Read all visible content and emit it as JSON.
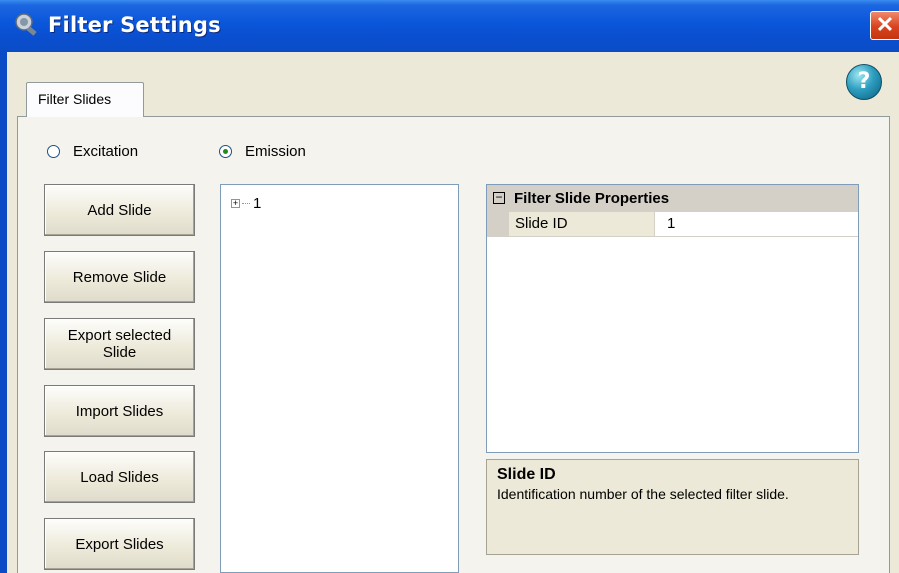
{
  "window": {
    "title": "Filter Settings",
    "close_glyph": "✕"
  },
  "help_glyph": "?",
  "tabs": [
    {
      "label": "Filter Slides"
    }
  ],
  "radios": {
    "excitation": {
      "label": "Excitation",
      "checked": false
    },
    "emission": {
      "label": "Emission",
      "checked": true
    }
  },
  "buttons": {
    "add": "Add Slide",
    "remove": "Remove Slide",
    "export_selected": "Export selected Slide",
    "import": "Import Slides",
    "load": "Load Slides",
    "export_all": "Export Slides"
  },
  "tree": {
    "nodes": [
      {
        "label": "1",
        "expander": "+"
      }
    ]
  },
  "properties": {
    "category": {
      "label": "Filter Slide Properties",
      "toggle": "−"
    },
    "rows": [
      {
        "name": "Slide ID",
        "value": "1"
      }
    ]
  },
  "description": {
    "title": "Slide ID",
    "text": "Identification number of the selected filter slide."
  }
}
